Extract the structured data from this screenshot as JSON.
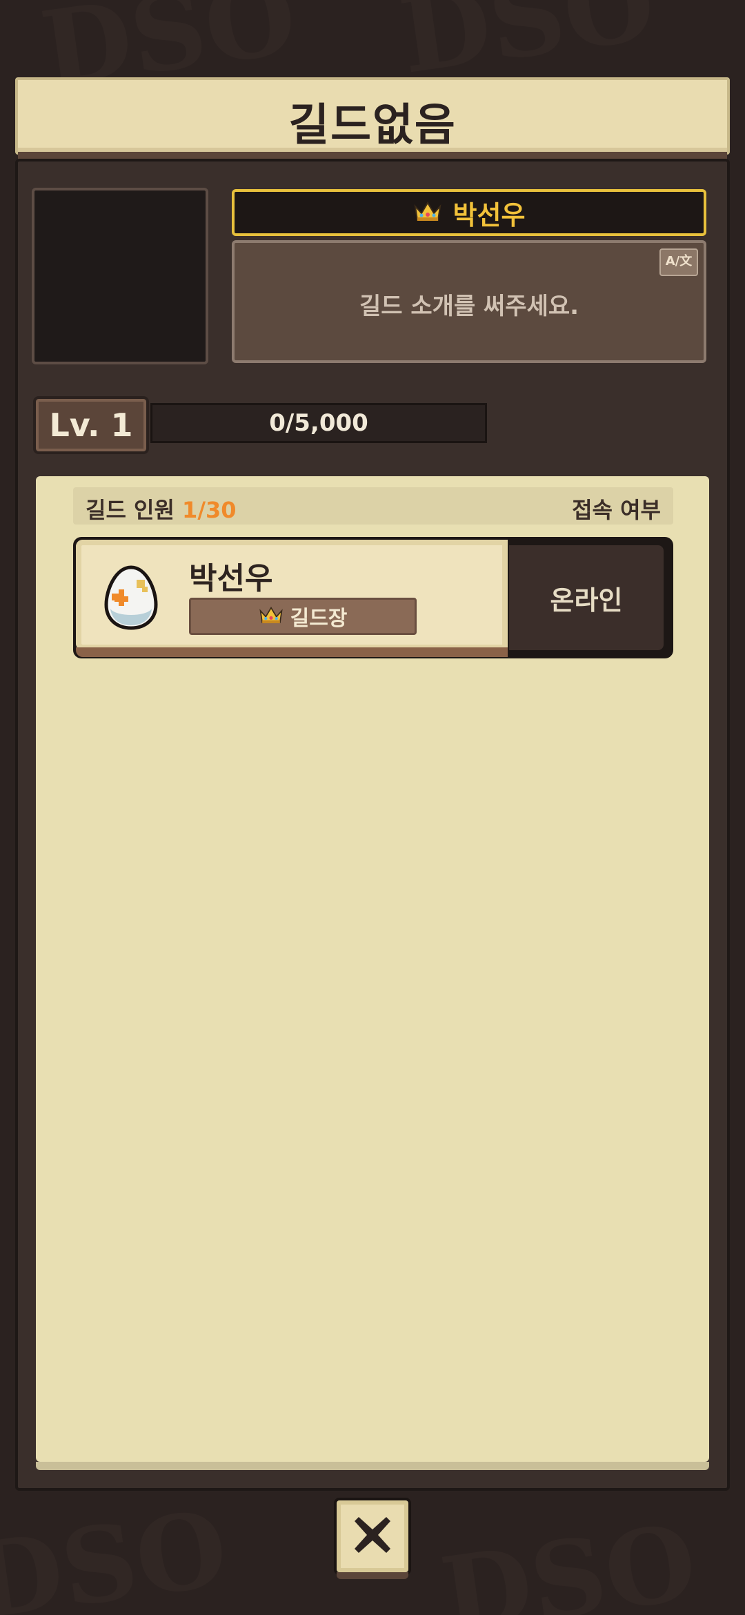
{
  "header": {
    "title": "길드없음"
  },
  "guild_info": {
    "leader_name": "박선우",
    "intro_placeholder": "길드 소개를 써주세요.",
    "translate_label": "A/文",
    "level_label": "Lv. 1",
    "xp_text": "0/5,000",
    "xp_fraction": 0
  },
  "members": {
    "header_label": "길드 인원",
    "count": "1/30",
    "status_header": "접속 여부",
    "list": [
      {
        "name": "박선우",
        "role": "길드장",
        "status": "온라인"
      }
    ]
  },
  "colors": {
    "accent": "#f2c23a",
    "count_orange": "#f08a2a"
  },
  "icons": {
    "crown": "crown-icon",
    "egg": "egg-avatar-icon",
    "close": "close-icon"
  }
}
